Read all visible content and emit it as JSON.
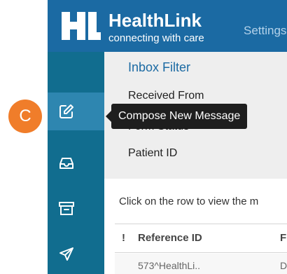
{
  "header": {
    "brand_name": "HealthLink",
    "brand_tagline": "connecting with care",
    "nav_settings": "Settings"
  },
  "sidebar": {
    "items": [
      {
        "icon": "compose-icon",
        "tooltip": "Compose New Message",
        "active": true
      },
      {
        "icon": "inbox-icon"
      },
      {
        "icon": "archive-icon"
      },
      {
        "icon": "send-icon"
      }
    ]
  },
  "filter_panel": {
    "title": "Inbox Filter",
    "labels": [
      "Received From",
      "Form Status",
      "Patient ID"
    ]
  },
  "hint": "Click on the row to view the m",
  "table": {
    "columns": [
      "!",
      "Reference ID",
      "F"
    ],
    "rows": [
      {
        "reference_id": "573^HealthLi..",
        "col3": "D"
      }
    ]
  },
  "marker": {
    "label": "C"
  },
  "colors": {
    "header_bg": "#1b6aa3",
    "sidebar_bg": "#116d8f",
    "active_item_bg": "#2e86b0",
    "marker": "#f07d2a",
    "tooltip_bg": "#1e1e1e"
  }
}
